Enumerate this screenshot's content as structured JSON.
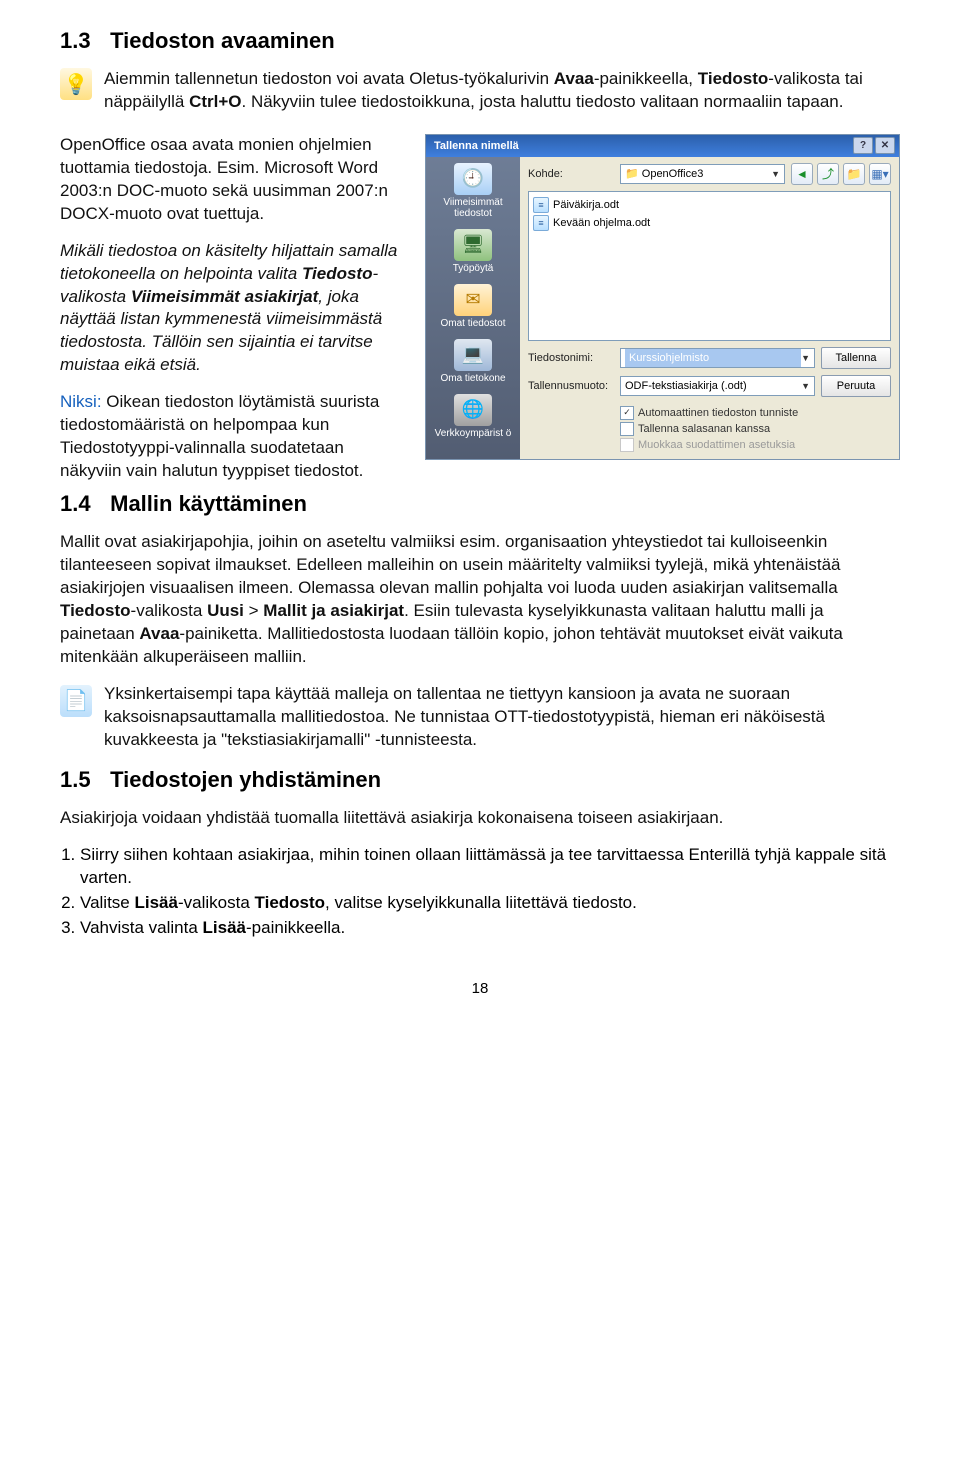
{
  "section13": {
    "num": "1.3",
    "title": "Tiedoston avaaminen",
    "p1_a": "Aiemmin tallennetun tiedoston voi avata Oletus-työkalurivin ",
    "p1_b": "Avaa",
    "p1_c": "-painikkeella, ",
    "p1_d": "Tiedosto",
    "p1_e": "-valikosta tai näppäilyllä ",
    "p1_f": "Ctrl+O",
    "p1_g": ". Näkyviin tulee tiedostoikkuna, josta haluttu tiedosto valitaan normaaliin tapaan.",
    "p2": "OpenOffice osaa avata monien ohjelmien tuottamia tiedostoja. Esim. Microsoft Word 2003:n DOC-muoto sekä uusimman 2007:n DOCX-muoto ovat tuettuja.",
    "p3_a": "Mikäli tiedostoa on käsitelty hiljattain samalla tietokoneella on helpointa valita ",
    "p3_b": "Tiedosto",
    "p3_c": "-valikosta ",
    "p3_d": "Viimeisimmät asiakirjat",
    "p3_e": ", joka näyttää listan kymmenestä viimeisimmästä tiedostosta. Tällöin sen sijaintia ei tarvitse muistaa eikä etsiä.",
    "p4_a": "Niksi:",
    "p4_b": " Oikean tiedoston löytämistä suurista tiedostomääristä on helpompaa kun Tiedostotyyppi-valinnalla suodatetaan näkyviin vain halutun tyyppiset tiedostot."
  },
  "dialog": {
    "title": "Tallenna nimellä",
    "target_label": "Kohde:",
    "target_value": "OpenOffice3",
    "sidebar": {
      "recent": "Viimeisimmät tiedostot",
      "desktop": "Työpöytä",
      "own": "Omat tiedostot",
      "pc": "Oma tietokone",
      "net": "Verkkoympärist ö"
    },
    "files": [
      "Päiväkirja.odt",
      "Kevään ohjelma.odt"
    ],
    "filename_label": "Tiedostonimi:",
    "filename_value": "Kurssiohjelmisto",
    "filetype_label": "Tallennusmuoto:",
    "filetype_value": "ODF-tekstiasiakirja (.odt)",
    "save_btn": "Tallenna",
    "cancel_btn": "Peruuta",
    "chk1": "Automaattinen tiedoston tunniste",
    "chk2": "Tallenna salasanan kanssa",
    "chk3": "Muokkaa suodattimen asetuksia"
  },
  "section14": {
    "num": "1.4",
    "title": "Mallin käyttäminen",
    "p1_a": "Mallit ovat asiakirjapohjia, joihin on aseteltu valmiiksi esim. organisaation yhteystiedot tai kulloiseenkin tilanteeseen sopivat ilmaukset. Edelleen malleihin on usein määritelty valmiiksi tyylejä, mikä yhtenäistää asiakirjojen visuaalisen ilmeen. Olemassa olevan mallin pohjalta voi luoda uuden asiakirjan valitsemalla ",
    "p1_b": "Tiedosto",
    "p1_c": "-valikosta ",
    "p1_d": "Uusi",
    "p1_e": " > ",
    "p1_f": "Mallit ja asiakirjat",
    "p1_g": ". Esiin tulevasta kyselyikkunasta valitaan haluttu malli ja painetaan ",
    "p1_h": "Avaa",
    "p1_i": "-painiketta. Mallitiedostosta luodaan tällöin kopio, johon tehtävät muutokset eivät vaikuta mitenkään alkuperäiseen malliin.",
    "tip": "Yksinkertaisempi tapa käyttää malleja on tallentaa ne tiettyyn kansioon ja avata ne suoraan kaksoisnapsauttamalla mallitiedostoa. Ne tunnistaa OTT-tiedostotyypistä, hieman eri näköisestä kuvakkeesta ja \"tekstiasiakirjamalli\" -tunnisteesta."
  },
  "section15": {
    "num": "1.5",
    "title": "Tiedostojen yhdistäminen",
    "intro": "Asiakirjoja voidaan yhdistää tuomalla liitettävä asiakirja kokonaisena toiseen asiakirjaan.",
    "li1": "Siirry siihen kohtaan asiakirjaa, mihin toinen ollaan liittämässä ja tee tarvittaessa Enterillä tyhjä kappale sitä varten.",
    "li2_a": "Valitse ",
    "li2_b": "Lisää",
    "li2_c": "-valikosta ",
    "li2_d": "Tiedosto",
    "li2_e": ", valitse kyselyikkunalla liitettävä tiedosto.",
    "li3_a": "Vahvista valinta ",
    "li3_b": "Lisää",
    "li3_c": "-painikkeella."
  },
  "pagenum": "18"
}
